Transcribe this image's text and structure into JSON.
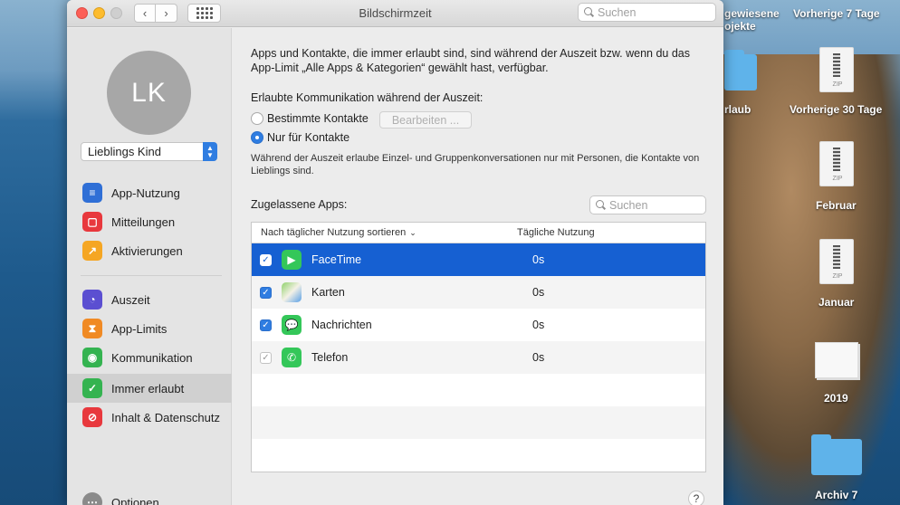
{
  "window": {
    "title": "Bildschirmzeit",
    "search_placeholder": "Suchen"
  },
  "sidebar": {
    "avatar_initials": "LK",
    "user_selected": "Lieblings Kind",
    "items": [
      {
        "label": "App-Nutzung",
        "icon": "layers-icon",
        "color": "#2f6fd6"
      },
      {
        "label": "Mitteilungen",
        "icon": "notification-icon",
        "color": "#e8383d"
      },
      {
        "label": "Aktivierungen",
        "icon": "pickup-icon",
        "color": "#f5a623"
      },
      {
        "label": "Auszeit",
        "icon": "downtime-icon",
        "color": "#5b4fd1"
      },
      {
        "label": "App-Limits",
        "icon": "hourglass-icon",
        "color": "#f08a24"
      },
      {
        "label": "Kommunikation",
        "icon": "person-icon",
        "color": "#34b350"
      },
      {
        "label": "Immer erlaubt",
        "icon": "checkmark-shield-icon",
        "color": "#34b350"
      },
      {
        "label": "Inhalt & Datenschutz",
        "icon": "restriction-icon",
        "color": "#e8383d"
      },
      {
        "label": "Optionen",
        "icon": "ellipsis-icon",
        "color": "#8a8a8a"
      }
    ]
  },
  "main": {
    "intro": "Apps und Kontakte, die immer erlaubt sind, sind während der Auszeit bzw. wenn du das App-Limit „Alle Apps & Kategorien“ gewählt hast, verfügbar.",
    "communication_label": "Erlaubte Kommunikation während der Auszeit:",
    "radio_specific": "Bestimmte Kontakte",
    "edit_button": "Bearbeiten ...",
    "radio_contacts_only": "Nur für Kontakte",
    "hint": "Während der Auszeit erlaube Einzel- und Gruppenkonversationen nur mit Personen, die Kontakte von Lieblings sind.",
    "apps_label": "Zugelassene Apps:",
    "apps_search_placeholder": "Suchen",
    "table": {
      "col_sort": "Nach täglicher Nutzung sortieren",
      "col_usage": "Tägliche Nutzung",
      "rows": [
        {
          "name": "FaceTime",
          "usage": "0s",
          "icon": "facetime-icon"
        },
        {
          "name": "Karten",
          "usage": "0s",
          "icon": "maps-icon"
        },
        {
          "name": "Nachrichten",
          "usage": "0s",
          "icon": "messages-icon"
        },
        {
          "name": "Telefon",
          "usage": "0s",
          "icon": "phone-icon"
        }
      ]
    },
    "help": "?"
  },
  "desktop": {
    "items": [
      "gewiesene\nojekte",
      "Vorherige 7 Tage",
      "rlaub",
      "Vorherige 30 Tage",
      "Februar",
      "Januar",
      "2019",
      "Archiv 7"
    ]
  }
}
